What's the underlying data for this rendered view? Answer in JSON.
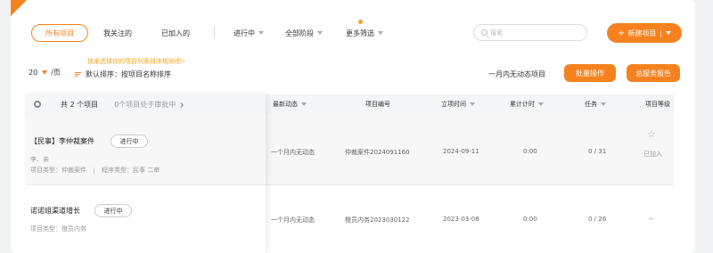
{
  "tabs": {
    "all": "所有项目",
    "followed": "我关注的",
    "joined": "已加入的",
    "in_progress": "进行中",
    "all_stages": "全部阶段",
    "more_filters": "更多筛选"
  },
  "search": {
    "placeholder": "搜索"
  },
  "new_project_button": "新建项目",
  "page_size": {
    "value": "20",
    "unit": "/页"
  },
  "tip": "快来选择你的项目列表排序规则吧~",
  "sort_label": "默认排序：按项目名称排序",
  "inactive_label": "一月内无动态项目",
  "batch_button": "批量操作",
  "report_button": "总服务报告",
  "left_header": {
    "count": "共 2 个项目",
    "approval": "0个项目处于审批中"
  },
  "table_headers": [
    "最新动态",
    "项目编号",
    "立项时间",
    "累计计时",
    "任务",
    "项目等级"
  ],
  "projects": [
    {
      "name": "【民事】李仲裁案件",
      "status": "进行中",
      "members": "李、亲",
      "type": "项目类型：仲裁案件",
      "procedure": "程序类型：民事 二审",
      "latest": "一个月内无动态",
      "code": "仲裁案件2024091160",
      "date": "2024-09-11",
      "time": "0:00",
      "tasks": "0 / 31",
      "level": "已加入"
    },
    {
      "name": "诺诺组渠道增长",
      "status": "进行中",
      "type": "项目类型：橙员内务",
      "latest": "一个月内无动态",
      "code": "橙员内务2023030122",
      "date": "2023-03-08",
      "time": "0:00",
      "tasks": "0 / 26",
      "level": "--"
    }
  ],
  "colors": {
    "accent": "#f5821f",
    "tip": "#f5a623"
  }
}
